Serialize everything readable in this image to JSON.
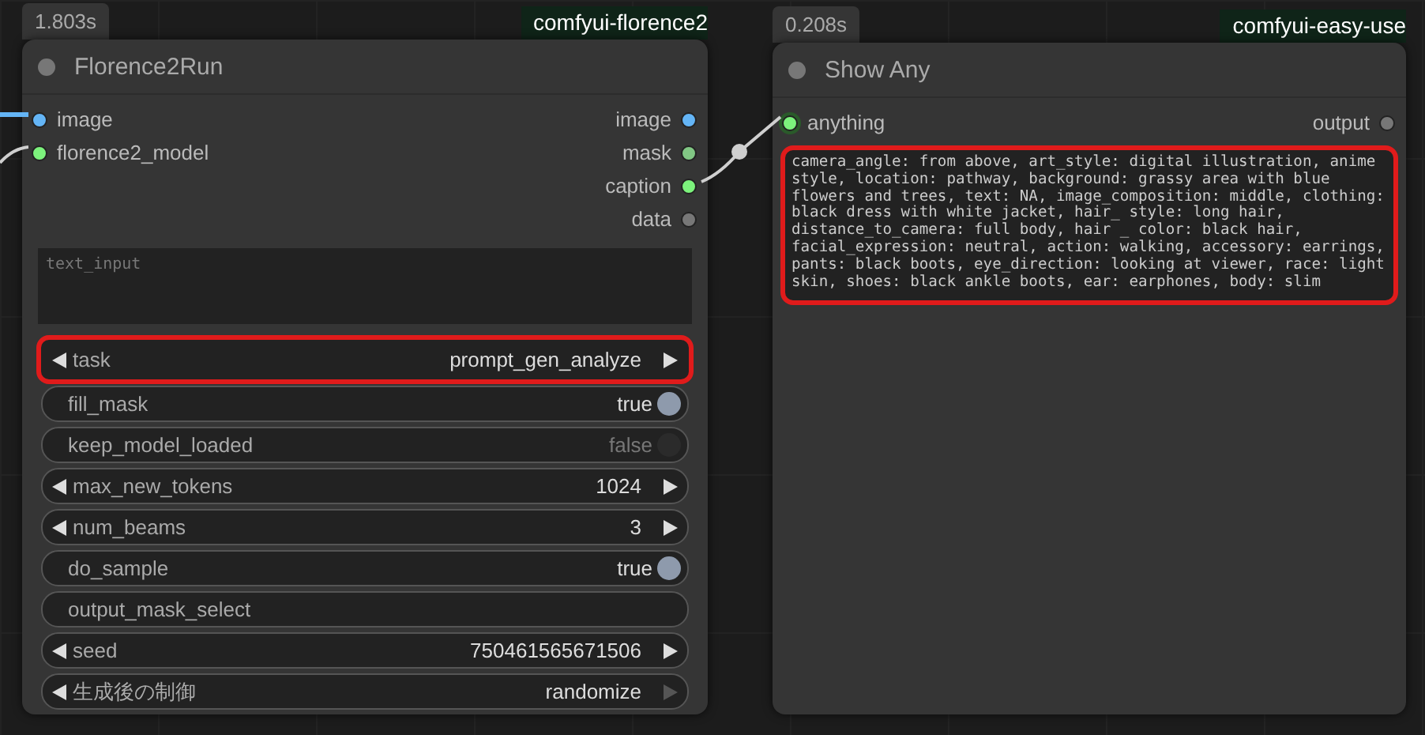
{
  "nodes": [
    {
      "time": "1.803s",
      "source": "comfyui-florence2",
      "title": "Florence2Run",
      "inputs": [
        {
          "name": "image",
          "color": "#64b5f6"
        },
        {
          "name": "florence2_model",
          "color": "#7cf27c"
        }
      ],
      "outputs": [
        {
          "name": "image",
          "color": "#64b5f6"
        },
        {
          "name": "mask",
          "color": "#81c784"
        },
        {
          "name": "caption",
          "color": "#7cf27c"
        },
        {
          "name": "data",
          "color": "#777777"
        }
      ],
      "text_area": {
        "placeholder": "text_input",
        "highlighted": false
      },
      "widgets": [
        {
          "kind": "combo",
          "label": "task",
          "value": "prompt_gen_analyze",
          "highlighted": true,
          "right_disabled": false
        },
        {
          "kind": "toggle",
          "label": "fill_mask",
          "value": "true",
          "on": true
        },
        {
          "kind": "toggle",
          "label": "keep_model_loaded",
          "value": "false",
          "on": false
        },
        {
          "kind": "combo",
          "label": "max_new_tokens",
          "value": "1024",
          "highlighted": false,
          "right_disabled": false
        },
        {
          "kind": "combo",
          "label": "num_beams",
          "value": "3",
          "highlighted": false,
          "right_disabled": false
        },
        {
          "kind": "toggle",
          "label": "do_sample",
          "value": "true",
          "on": true
        },
        {
          "kind": "text",
          "label": "output_mask_select"
        },
        {
          "kind": "combo",
          "label": "seed",
          "value": "750461565671506",
          "highlighted": false,
          "right_disabled": false
        },
        {
          "kind": "combo",
          "label": "生成後の制御",
          "value": "randomize",
          "highlighted": false,
          "right_disabled": true
        }
      ]
    },
    {
      "time": "0.208s",
      "source": "comfyui-easy-use",
      "title": "Show Any",
      "inputs": [
        {
          "name": "anything",
          "color": "#7cf27c"
        }
      ],
      "outputs": [
        {
          "name": "output",
          "color": "#777777"
        }
      ],
      "text_area": {
        "value": "camera_angle: from above, art_style: digital illustration, anime style, location: pathway, background: grassy area with blue flowers and trees, text: NA, image_composition: middle, clothing: black dress with white jacket, hair_ style: long hair, distance_to_camera: full body, hair _ color: black hair, facial_expression: neutral, action: walking, accessory: earrings, pants: black boots, eye_direction: looking at viewer, race: light skin, shoes: black ankle boots, ear: earphones, body: slim",
        "highlighted": true
      }
    }
  ]
}
